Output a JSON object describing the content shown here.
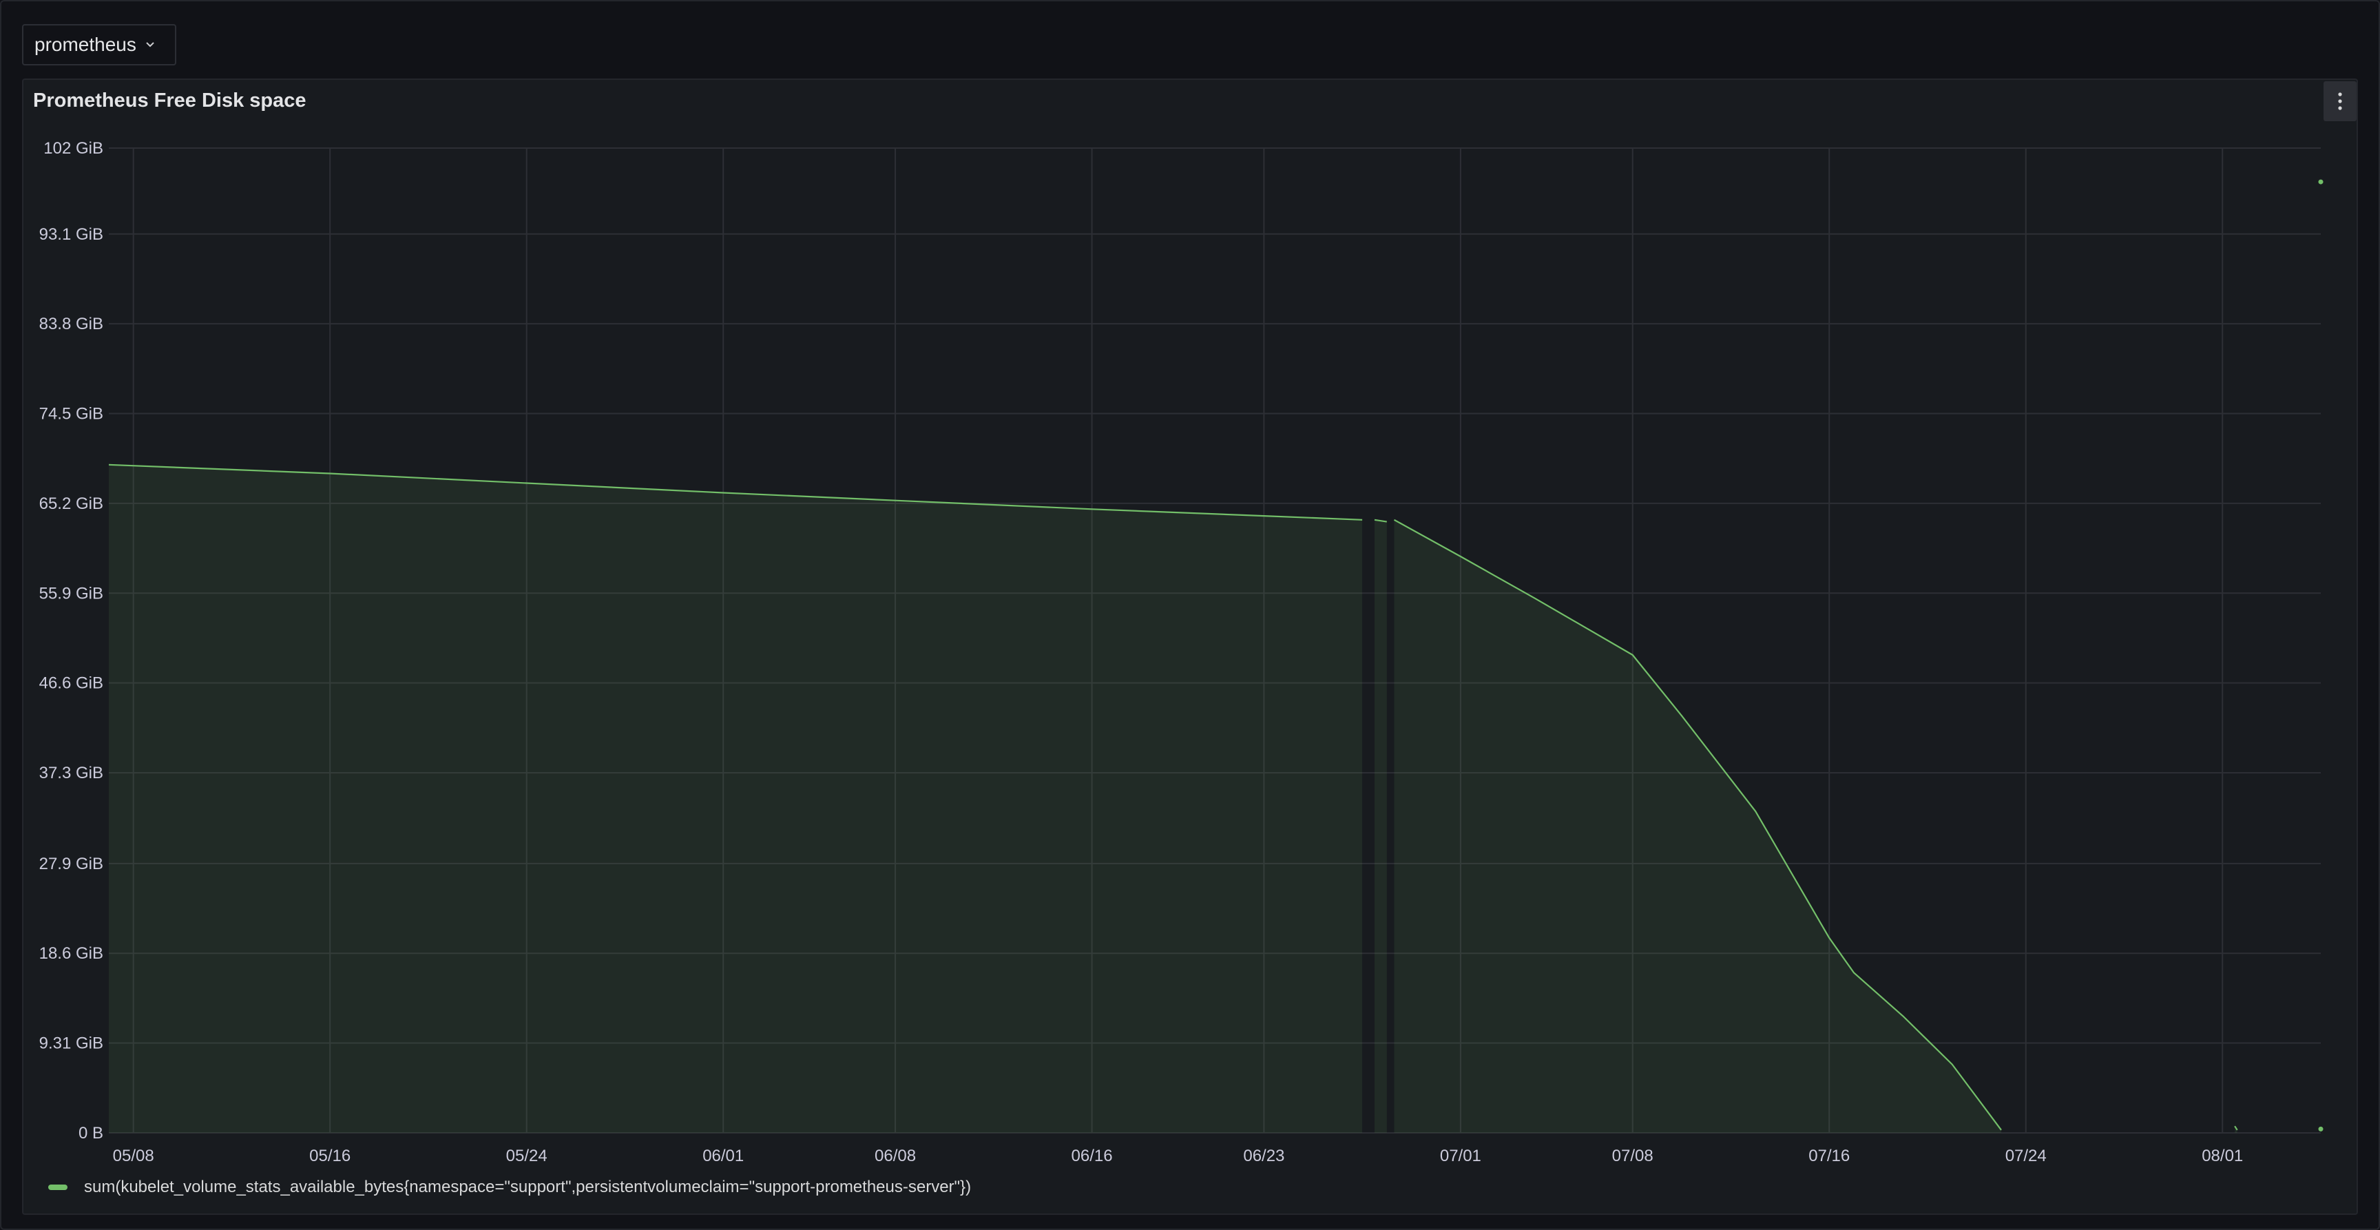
{
  "datasource": {
    "selected": "prometheus",
    "chevron_icon": "chevron-down-icon"
  },
  "panel": {
    "title": "Prometheus Free Disk space",
    "menu_icon": "kebab-menu-icon"
  },
  "colors": {
    "series": "#73bf69",
    "grid": "#2d2f35",
    "panel_bg": "#181b1f"
  },
  "chart_data": {
    "type": "area",
    "title": "Prometheus Free Disk space",
    "xlabel": "",
    "ylabel": "",
    "y_unit": "GiB",
    "ylim": [
      0,
      102
    ],
    "y_ticks": [
      {
        "value": 0,
        "label": "0 B"
      },
      {
        "value": 9.31,
        "label": "9.31 GiB"
      },
      {
        "value": 18.6,
        "label": "18.6 GiB"
      },
      {
        "value": 27.9,
        "label": "27.9 GiB"
      },
      {
        "value": 37.3,
        "label": "37.3 GiB"
      },
      {
        "value": 46.6,
        "label": "46.6 GiB"
      },
      {
        "value": 55.9,
        "label": "55.9 GiB"
      },
      {
        "value": 65.2,
        "label": "65.2 GiB"
      },
      {
        "value": 74.5,
        "label": "74.5 GiB"
      },
      {
        "value": 83.8,
        "label": "83.8 GiB"
      },
      {
        "value": 93.1,
        "label": "93.1 GiB"
      },
      {
        "value": 102,
        "label": "102 GiB"
      }
    ],
    "xlim": [
      "2024-05-07",
      "2024-08-05"
    ],
    "x_ticks": [
      {
        "date": "2024-05-08",
        "label": "05/08"
      },
      {
        "date": "2024-05-16",
        "label": "05/16"
      },
      {
        "date": "2024-05-24",
        "label": "05/24"
      },
      {
        "date": "2024-06-01",
        "label": "06/01"
      },
      {
        "date": "2024-06-08",
        "label": "06/08"
      },
      {
        "date": "2024-06-16",
        "label": "06/16"
      },
      {
        "date": "2024-06-23",
        "label": "06/23"
      },
      {
        "date": "2024-07-01",
        "label": "07/01"
      },
      {
        "date": "2024-07-08",
        "label": "07/08"
      },
      {
        "date": "2024-07-16",
        "label": "07/16"
      },
      {
        "date": "2024-07-24",
        "label": "07/24"
      },
      {
        "date": "2024-08-01",
        "label": "08/01"
      }
    ],
    "grid": true,
    "legend_position": "bottom-left",
    "series": [
      {
        "name": "sum(kubelet_volume_stats_available_bytes{namespace=\"support\",persistentvolumeclaim=\"support-prometheus-server\"})",
        "segments": [
          [
            {
              "x": "2024-05-07",
              "y": 69.2
            },
            {
              "x": "2024-05-16",
              "y": 68.3
            },
            {
              "x": "2024-05-24",
              "y": 67.3
            },
            {
              "x": "2024-06-01",
              "y": 66.3
            },
            {
              "x": "2024-06-08",
              "y": 65.5
            },
            {
              "x": "2024-06-16",
              "y": 64.6
            },
            {
              "x": "2024-06-23",
              "y": 63.9
            },
            {
              "x": "2024-06-27",
              "y": 63.5
            }
          ],
          [
            {
              "x": "2024-06-27.5",
              "y": 63.5
            },
            {
              "x": "2024-06-28",
              "y": 63.3
            }
          ],
          [
            {
              "x": "2024-06-28.3",
              "y": 63.5
            },
            {
              "x": "2024-07-01",
              "y": 59.7
            },
            {
              "x": "2024-07-04",
              "y": 55.4
            },
            {
              "x": "2024-07-08",
              "y": 49.5
            },
            {
              "x": "2024-07-10",
              "y": 43.2
            },
            {
              "x": "2024-07-13",
              "y": 33.3
            },
            {
              "x": "2024-07-16",
              "y": 20.2
            },
            {
              "x": "2024-07-17",
              "y": 16.6
            },
            {
              "x": "2024-07-19",
              "y": 12.1
            },
            {
              "x": "2024-07-21",
              "y": 7.1
            },
            {
              "x": "2024-07-23",
              "y": 0.3
            }
          ],
          [
            {
              "x": "2024-08-01.5",
              "y": 0.7
            },
            {
              "x": "2024-08-01.6",
              "y": 0.3
            }
          ],
          [
            {
              "x": "2024-08-05",
              "y": 0.4
            }
          ],
          [
            {
              "x": "2024-08-06",
              "y": 98.5
            }
          ]
        ]
      }
    ]
  }
}
